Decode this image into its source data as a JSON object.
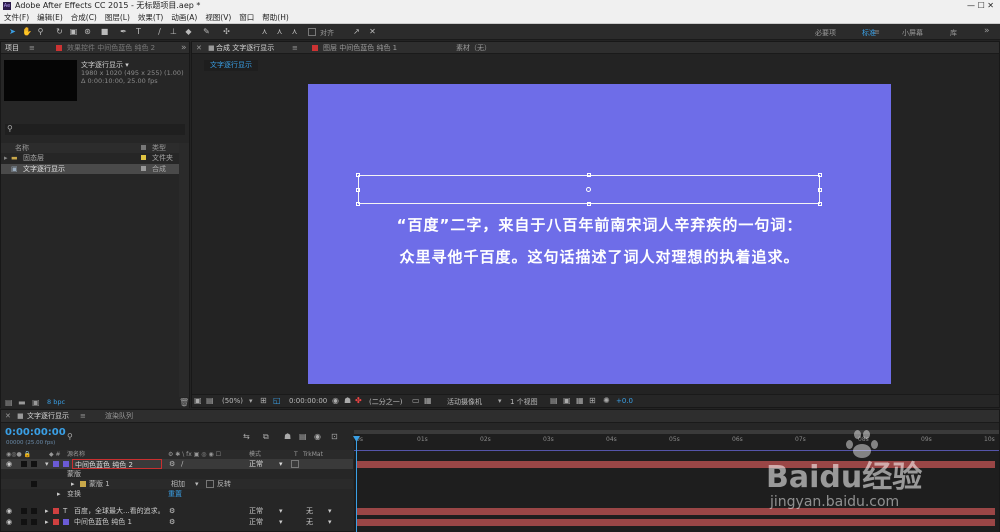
{
  "titlebar": {
    "app_icon": "Ae",
    "title": "Adobe After Effects CC 2015 - 无标题项目.aep *"
  },
  "menu": [
    "文件(F)",
    "编辑(E)",
    "合成(C)",
    "图层(L)",
    "效果(T)",
    "动画(A)",
    "视图(V)",
    "窗口",
    "帮助(H)"
  ],
  "toolbar": {
    "align_label": "对齐",
    "workspaces": [
      "必要项",
      "标准",
      "小屏幕",
      "库"
    ],
    "active_workspace": "标准",
    "overflow": "»"
  },
  "project_panel": {
    "tab_label": "项目",
    "tab_menu": "≡",
    "effects_tab_label": "效果控件 中间色蓝色 纯色 2",
    "overflow": "»",
    "comp_name": "文字逐行显示 ▾",
    "comp_size": "1980 x 1020  (495 x 255) (1.00)",
    "comp_duration": "Δ 0:00:10:00, 25.00 fps",
    "search_placeholder": "",
    "columns": {
      "name": "名称",
      "type": "类型"
    },
    "items": [
      {
        "name": "固态层",
        "type": "文件夹",
        "kind": "folder"
      },
      {
        "name": "文字逐行显示",
        "type": "合成",
        "kind": "comp"
      }
    ],
    "bpc": "8 bpc"
  },
  "comp_panel": {
    "tabs": [
      "合成 文字逐行显示",
      "图层 中间色蓝色 纯色 1",
      "素材（无）"
    ],
    "active_tab": "合成 文字逐行显示",
    "comp_chip": "文字逐行显示",
    "canvas_color": "#6e6de8",
    "text_line1": "“百度”二字，来自于八百年前南宋词人辛弃疾的一句词：",
    "text_line2": "众里寻他千百度。这句话描述了词人对理想的执着追求。",
    "footer": {
      "zoom": "(50%)",
      "timecode": "0:00:00:00",
      "resolution": "(二分之一)",
      "camera": "活动摄像机",
      "views": "1 个视图",
      "exposure": "+0.0"
    }
  },
  "timeline": {
    "tab_label": "文字逐行显示",
    "render_tab_label": "渲染队列",
    "tab_menu": "≡",
    "timecode": "0:00:00:00",
    "fps_info": "00000 (25.00 fps)",
    "columns": {
      "source": "源名称",
      "mode": "模式",
      "t": "T",
      "trkmat": "TrkMat"
    },
    "layers": [
      {
        "num": "1",
        "name": "中间色蓝色 纯色 2",
        "mode": "正常",
        "trkmat": "",
        "color": "#6b5bd6",
        "selected": true
      },
      {
        "num": "2",
        "name": "百度，全球最大...看的追求。",
        "mode": "正常",
        "trkmat": "无",
        "color": "#d04040",
        "selected": false
      },
      {
        "num": "3",
        "name": "中间色蓝色 纯色 1",
        "mode": "正常",
        "trkmat": "无",
        "color": "#6b5bd6",
        "selected": false
      }
    ],
    "mask_group_label": "蒙版",
    "mask_label": "蒙版 1",
    "mask_mode": "相加",
    "mask_invert_label": "反转",
    "transform_label": "变换",
    "transform_reset": "重置",
    "ruler_ticks": [
      "0s",
      "01s",
      "02s",
      "03s",
      "04s",
      "05s",
      "06s",
      "07s",
      "08s",
      "09s",
      "10s"
    ]
  },
  "watermark": {
    "text": "Baidu经验",
    "url": "jingyan.baidu.com"
  }
}
